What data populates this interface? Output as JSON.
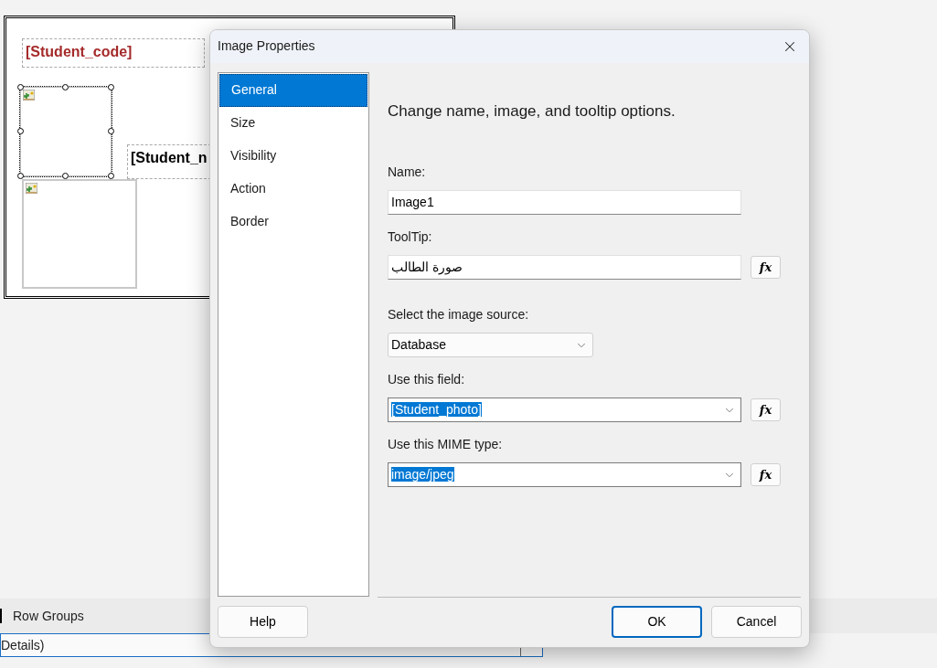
{
  "report": {
    "items": [
      {
        "kind": "textbox",
        "text": "[Student_code]",
        "color": "#a52a2a"
      },
      {
        "kind": "image",
        "selected": true
      },
      {
        "kind": "textbox",
        "text": "[Student_n",
        "color": "#000000"
      },
      {
        "kind": "image",
        "selected": false
      }
    ]
  },
  "row_groups": {
    "title": "Row Groups",
    "group": "Details)"
  },
  "dialog": {
    "title": "Image Properties",
    "pages": [
      {
        "label": "General",
        "selected": true
      },
      {
        "label": "Size",
        "selected": false
      },
      {
        "label": "Visibility",
        "selected": false
      },
      {
        "label": "Action",
        "selected": false
      },
      {
        "label": "Border",
        "selected": false
      }
    ],
    "heading": "Change name, image, and tooltip options.",
    "fields": [
      {
        "kind": "text",
        "label": "Name:",
        "value": "Image1",
        "highlighted": false
      },
      {
        "kind": "text",
        "label": "ToolTip:",
        "value": "صورة الطالب",
        "highlighted": false,
        "fx": "fx"
      },
      {
        "kind": "select",
        "label": "Select the image source:",
        "value": "Database",
        "highlighted": false
      },
      {
        "kind": "combo",
        "label": "Use this field:",
        "value": "[Student_photo]",
        "highlighted": true,
        "fx": "fx"
      },
      {
        "kind": "combo",
        "label": "Use this MIME type:",
        "value": "image/jpeg",
        "highlighted": true,
        "fx": "fx"
      }
    ],
    "buttons": [
      {
        "label": "Help",
        "default": false
      },
      {
        "label": "OK",
        "default": true
      },
      {
        "label": "Cancel",
        "default": false
      }
    ]
  }
}
